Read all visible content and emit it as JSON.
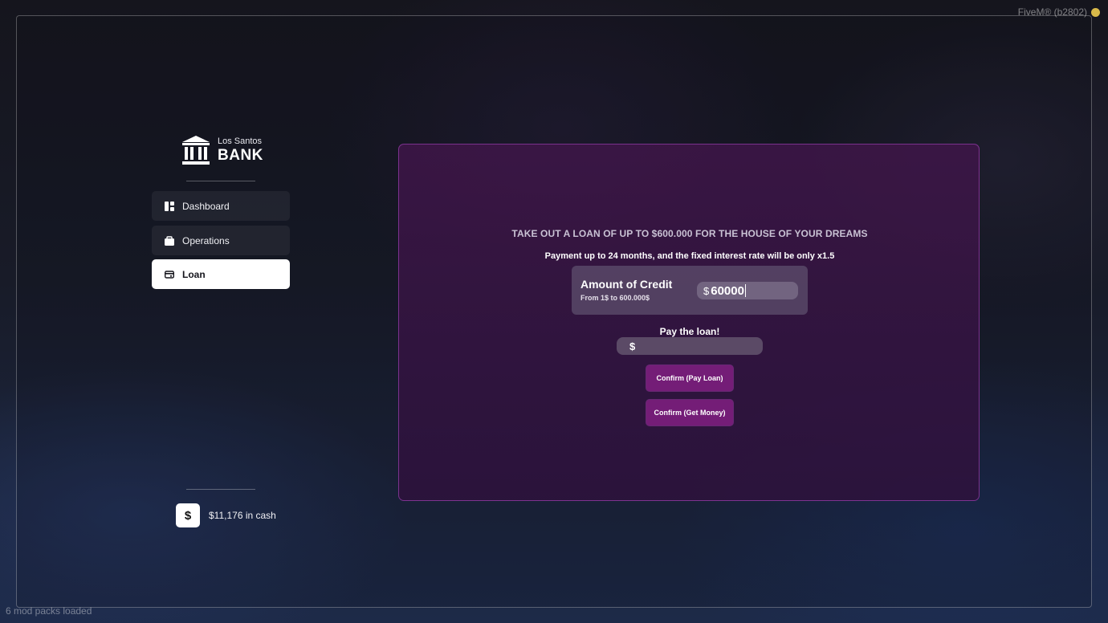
{
  "app": {
    "client_label": "FiveM® (b2802)",
    "status_text": "6 mod packs loaded"
  },
  "sidebar": {
    "logo": {
      "small_text": "Los Santos",
      "big_text": "BANK"
    },
    "items": [
      {
        "label": "Dashboard",
        "icon": "dashboard-icon",
        "active": false
      },
      {
        "label": "Operations",
        "icon": "wallet-icon",
        "active": false
      },
      {
        "label": "Loan",
        "icon": "loan-icon",
        "active": true
      }
    ],
    "cash": {
      "symbol": "$",
      "text": "$11,176 in cash"
    }
  },
  "loan": {
    "headline": "TAKE OUT A LOAN OF UP TO $600.000 FOR THE HOUSE OF YOUR DREAMS",
    "subline": "Payment up to 24 months, and the fixed interest rate will be only x1.5",
    "credit": {
      "title": "Amount of Credit",
      "range": "From 1$ to 600.000$",
      "currency": "$",
      "value": "60000"
    },
    "pay": {
      "label": "Pay the loan!",
      "currency": "$",
      "value": ""
    },
    "buttons": {
      "pay_loan": "Confirm (Pay Loan)",
      "get_money": "Confirm (Get Money)"
    }
  },
  "colors": {
    "accent": "#741d77",
    "panel_border": "#963caa",
    "active_nav": "#ffffff"
  }
}
